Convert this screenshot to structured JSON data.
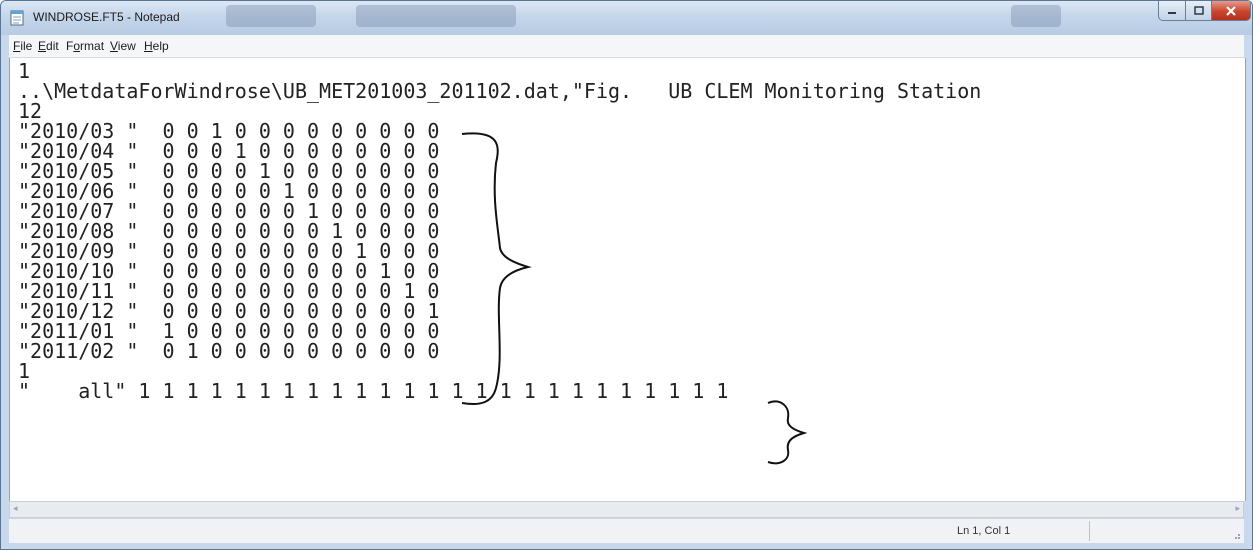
{
  "window": {
    "title": "WINDROSE.FT5 - Notepad"
  },
  "menu": [
    "File",
    "Edit",
    "Format",
    "View",
    "Help"
  ],
  "document": {
    "lines": [
      "1",
      "..\\MetdataForWindrose\\UB_MET201003_201102.dat,\"Fig.   UB CLEM Monitoring Station",
      "12",
      "\"2010/03 \"  0 0 1 0 0 0 0 0 0 0 0 0",
      "\"2010/04 \"  0 0 0 1 0 0 0 0 0 0 0 0",
      "\"2010/05 \"  0 0 0 0 1 0 0 0 0 0 0 0",
      "\"2010/06 \"  0 0 0 0 0 1 0 0 0 0 0 0",
      "\"2010/07 \"  0 0 0 0 0 0 1 0 0 0 0 0",
      "\"2010/08 \"  0 0 0 0 0 0 0 1 0 0 0 0",
      "\"2010/09 \"  0 0 0 0 0 0 0 0 1 0 0 0",
      "\"2010/10 \"  0 0 0 0 0 0 0 0 0 1 0 0",
      "\"2010/11 \"  0 0 0 0 0 0 0 0 0 0 1 0",
      "\"2010/12 \"  0 0 0 0 0 0 0 0 0 0 0 1",
      "\"2011/01 \"  1 0 0 0 0 0 0 0 0 0 0 0",
      "\"2011/02 \"  0 1 0 0 0 0 0 0 0 0 0 0",
      "1",
      "\"    all\" 1 1 1 1 1 1 1 1 1 1 1 1 1 1 1 1 1 1 1 1 1 1 1 1 1"
    ]
  },
  "status": {
    "position": "Ln 1, Col 1"
  }
}
